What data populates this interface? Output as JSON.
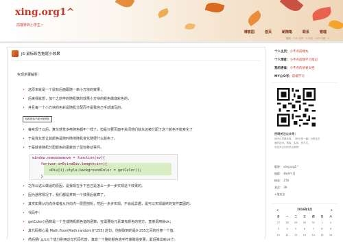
{
  "site": {
    "title": "xing.org1^",
    "subtitle": "前端界的小学生~"
  },
  "nav": [
    "博客园",
    "首页",
    "新随笔",
    "联系",
    "管理"
  ],
  "statusline": "随笔 - 125  文章 - 0  评论 - 102  引用 - 0",
  "post": {
    "title": "JS-鼠标彩色拖尾小效果",
    "paragraphs": [
      "实现步骤解析：",
      "这原本就是一个鼠标后面跟随一串小方块的效果，",
      "后来我就想，加个之前学的随机数的效果小方块的颜色做成彩色的，",
      "并且每一个小方块的色彩是随机分配而不是我自己手动填写的。",
      "每实现了以后，算又感觉多亮随色都不一样了，但是只要页面不关闭他们就永远被分配了这个颜色不能变化了",
      "于是我又想让其颜色是随时随地随机变化随便什么颜色了。",
      "于是就将随机分配颜色的函数放了鼠标移动事件。",
      "之所以这么做适的原因，是我现在手下自己是怎么一步一步实现这个效果的。",
      "因为通常情况下，我们都是拿到一个效果后就算了，",
      "其实如果从内向外或者从外向内一层层剖析，然后一步步实现，不会乱异据，是可以实现最终的安件案图的。",
      "代码中：",
      "getColor()函数是一个生成随机颜色值的函数，在需要给元素填充颜色的地方，直接调用就ok；",
      "其代码核心是 Math.floor(Math.random()*255) 这句，他获取到的是0-255之间的任意一个值，",
      "然后把r,g,b三个值分别用这句代码代替，凑成一个整的颜色值字符串赋给变量，最后弹出就ok了。"
    ],
    "tag": "随机颜色不能分配颜色",
    "code": [
      "window.onmousemove = function(ev){",
      "    for(var i=0;i<oDiv.length;i++){",
      "        oDiv[i].style.backgroundColor = getColor();",
      "    }"
    ]
  },
  "sidebar": {
    "rows": [
      {
        "label": "个人主页：",
        "value": "小不点前端丸"
      },
      {
        "label": "个人博客：",
        "value": "小不点前端学习笔记"
      },
      {
        "label": "我的语雀：",
        "value": "小不点的语雀文档"
      },
      {
        "label": "MY公众号：",
        "value": "前端学习"
      }
    ],
    "about_title": "扫码关注公众号：",
    "about_lines": [
      "我不小灵果你我，《有分享一篇》分享全方",
      "面的技术，笔者、实用、资方式，",
      "欢迎关注扫码关注推荐！"
    ],
    "stats": [
      "昵称： xing.org1^",
      "园龄： 4年9个月",
      "粉丝： 278",
      "关注： 39",
      "+加关注"
    ],
    "calendar": {
      "prev": "<",
      "month": "2016年1月",
      "next": ">",
      "weekdays": [
        "日",
        "一",
        "二",
        "三",
        "四",
        "五",
        "六"
      ],
      "days": [
        "27",
        "28",
        "29",
        "30",
        "31",
        "1",
        "2",
        "3",
        "4",
        "5",
        "6",
        "7",
        "8",
        "9",
        "10",
        "11",
        "12",
        "13",
        "14",
        "15",
        "16"
      ]
    }
  },
  "colors": {
    "accent": "#c0392b",
    "code_highlight": "#d8edc4",
    "header_bg": "#f6e7d3"
  }
}
